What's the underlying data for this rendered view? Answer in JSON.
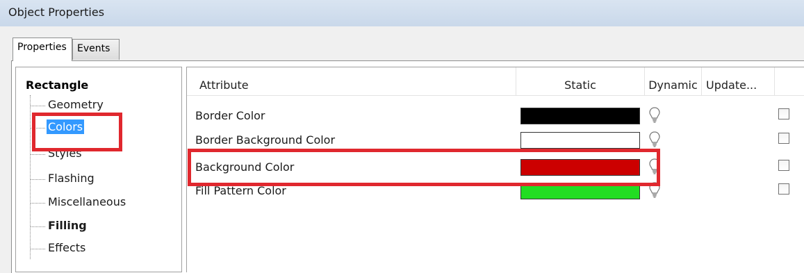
{
  "window": {
    "title": "Object Properties"
  },
  "tabs": [
    {
      "label": "Properties",
      "active": true
    },
    {
      "label": "Events",
      "active": false
    }
  ],
  "tree": {
    "root": "Rectangle",
    "items": [
      {
        "label": "Geometry",
        "selected": false,
        "bold": false
      },
      {
        "label": "Colors",
        "selected": true,
        "bold": false
      },
      {
        "label": "Styles",
        "selected": false,
        "bold": false
      },
      {
        "label": "Flashing",
        "selected": false,
        "bold": false
      },
      {
        "label": "Miscellaneous",
        "selected": false,
        "bold": false
      },
      {
        "label": "Filling",
        "selected": false,
        "bold": true
      },
      {
        "label": "Effects",
        "selected": false,
        "bold": false
      }
    ]
  },
  "grid": {
    "columns": [
      "Attribute",
      "Static",
      "Dynamic",
      "Update..."
    ],
    "rows": [
      {
        "attribute": "Border Color",
        "color": "#000000"
      },
      {
        "attribute": "Border Background Color",
        "color": "#ffffff"
      },
      {
        "attribute": "Background Color",
        "color": "#cc0000"
      },
      {
        "attribute": "Fill Pattern Color",
        "color": "#22dd22"
      }
    ]
  },
  "colors": {
    "highlight": "#e0282e",
    "selection": "#3399ff"
  }
}
